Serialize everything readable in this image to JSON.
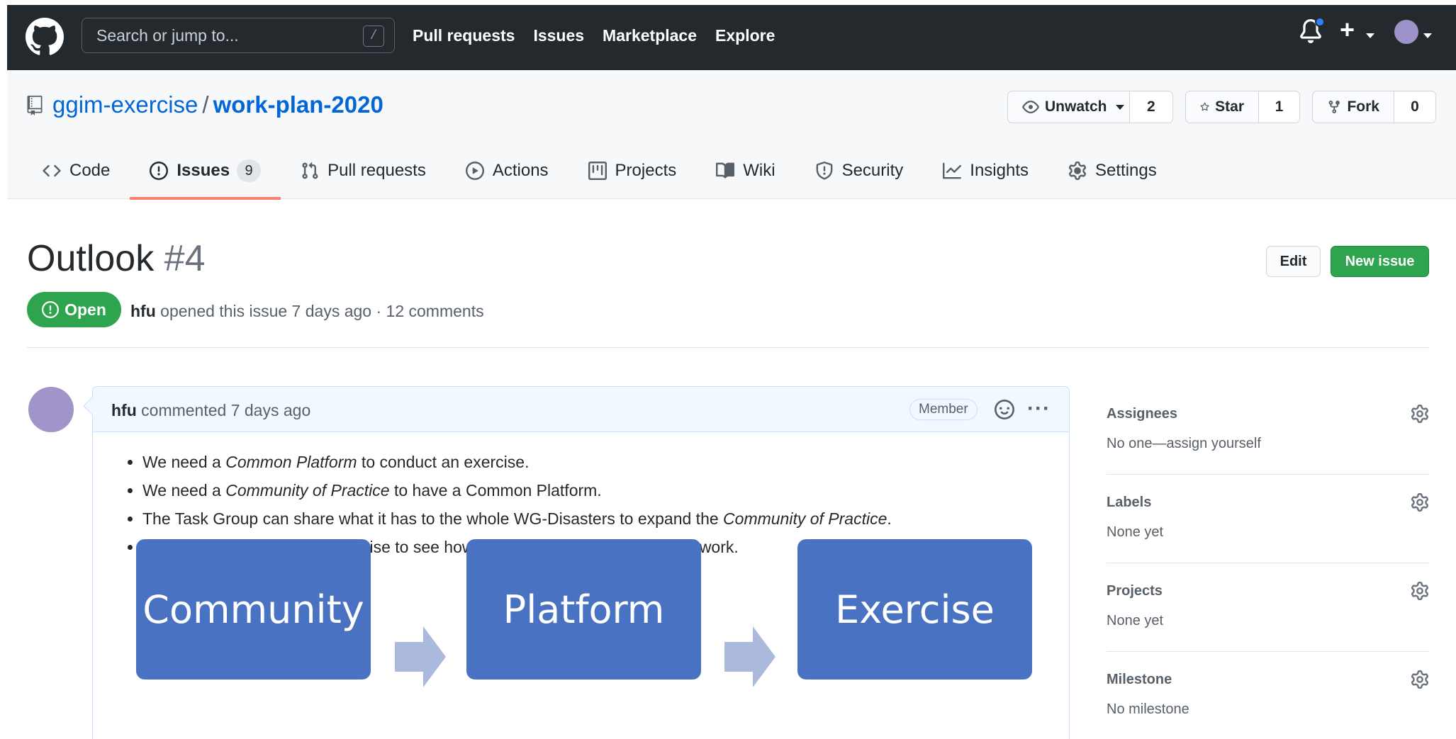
{
  "header": {
    "search_placeholder": "Search or jump to...",
    "search_shortcut": "/",
    "nav": [
      "Pull requests",
      "Issues",
      "Marketplace",
      "Explore"
    ],
    "plus": "+"
  },
  "repo": {
    "owner": "ggim-exercise",
    "separator": "/",
    "name": "work-plan-2020",
    "watch_label": "Unwatch",
    "watch_count": "2",
    "star_label": "Star",
    "star_count": "1",
    "fork_label": "Fork",
    "fork_count": "0"
  },
  "tabs": [
    {
      "label": "Code"
    },
    {
      "label": "Issues",
      "count": "9"
    },
    {
      "label": "Pull requests"
    },
    {
      "label": "Actions"
    },
    {
      "label": "Projects"
    },
    {
      "label": "Wiki"
    },
    {
      "label": "Security"
    },
    {
      "label": "Insights"
    },
    {
      "label": "Settings"
    }
  ],
  "issue": {
    "title": "Outlook",
    "number": "#4",
    "edit_label": "Edit",
    "new_issue_label": "New issue",
    "state": "Open",
    "author": "hfu",
    "meta_text": "opened this issue 7 days ago · 12 comments"
  },
  "comment": {
    "author": "hfu",
    "action": "commented 7 days ago",
    "role": "Member",
    "menu": "···",
    "bullets": [
      {
        "pre": "We need a ",
        "em": "Common Platform",
        "post": " to conduct an exercise."
      },
      {
        "pre": "We need a ",
        "em": "Community of Practice",
        "post": " to have a Common Platform."
      },
      {
        "pre": "The Task Group can share what it has to the whole WG-Disasters to expand the ",
        "em": "Community of Practice",
        "post": "."
      },
      {
        "pre": "We can have a simulated exercise to see how applicable the Strategic Framework.",
        "em": "",
        "post": ""
      }
    ],
    "flow": [
      "Community",
      "Platform",
      "Exercise"
    ]
  },
  "sidebar": {
    "assignees_title": "Assignees",
    "assignees_value": "No one—assign yourself",
    "labels_title": "Labels",
    "labels_value": "None yet",
    "projects_title": "Projects",
    "projects_value": "None yet",
    "milestone_title": "Milestone",
    "milestone_value": "No milestone"
  },
  "colors": {
    "header_bg": "#24292e",
    "link": "#0366d6",
    "open_green": "#2ea44f",
    "tab_underline": "#f9826c",
    "flow_box": "#4a72c2",
    "flow_arrow": "#aab9dc"
  }
}
